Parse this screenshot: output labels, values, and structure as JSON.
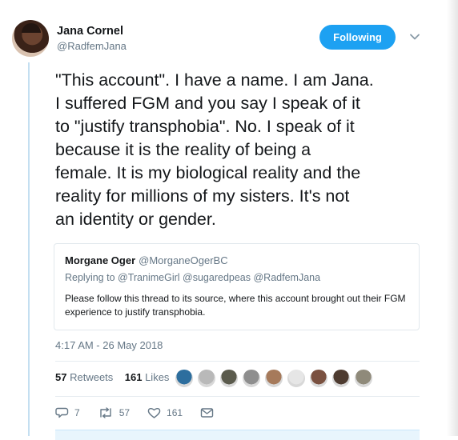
{
  "author": {
    "name": "Jana Cornel",
    "handle": "@RadfemJana",
    "follow_label": "Following"
  },
  "tweet": {
    "lines": [
      "\"This account\". I have a name. I am Jana.",
      "I suffered FGM and you say I speak of it",
      "to \"justify transphobia\". No. I speak of it",
      "because it is the reality of being a",
      "female. It is my biological reality and the",
      "reality for millions of my sisters. It's not",
      "an identity or gender."
    ],
    "timestamp": "4:17 AM - 26 May 2018"
  },
  "quote": {
    "name": "Morgane Oger",
    "handle": "@MorganeOgerBC",
    "replying_prefix": "Replying to",
    "replying_to": [
      "@TranimeGirl",
      "@sugaredpeas",
      "@RadfemJana"
    ],
    "text": "Please follow this thread to its source, where this account brought out their FGM experience to justify transphobia."
  },
  "stats": {
    "retweets_count": "57",
    "retweets_label": "Retweets",
    "likes_count": "161",
    "likes_label": "Likes"
  },
  "liker_avatars": [
    "#2d6e9e",
    "#b9b9b9",
    "#5b5b4d",
    "#8e8e8e",
    "#a67a5b",
    "#e6e6e6",
    "#7a5140",
    "#4e3b30",
    "#8f8a7a"
  ],
  "actions": {
    "reply_count": "7",
    "retweet_count": "57",
    "like_count": "161"
  },
  "colors": {
    "accent": "#1da1f2",
    "muted": "#657786",
    "text": "#14171a"
  }
}
